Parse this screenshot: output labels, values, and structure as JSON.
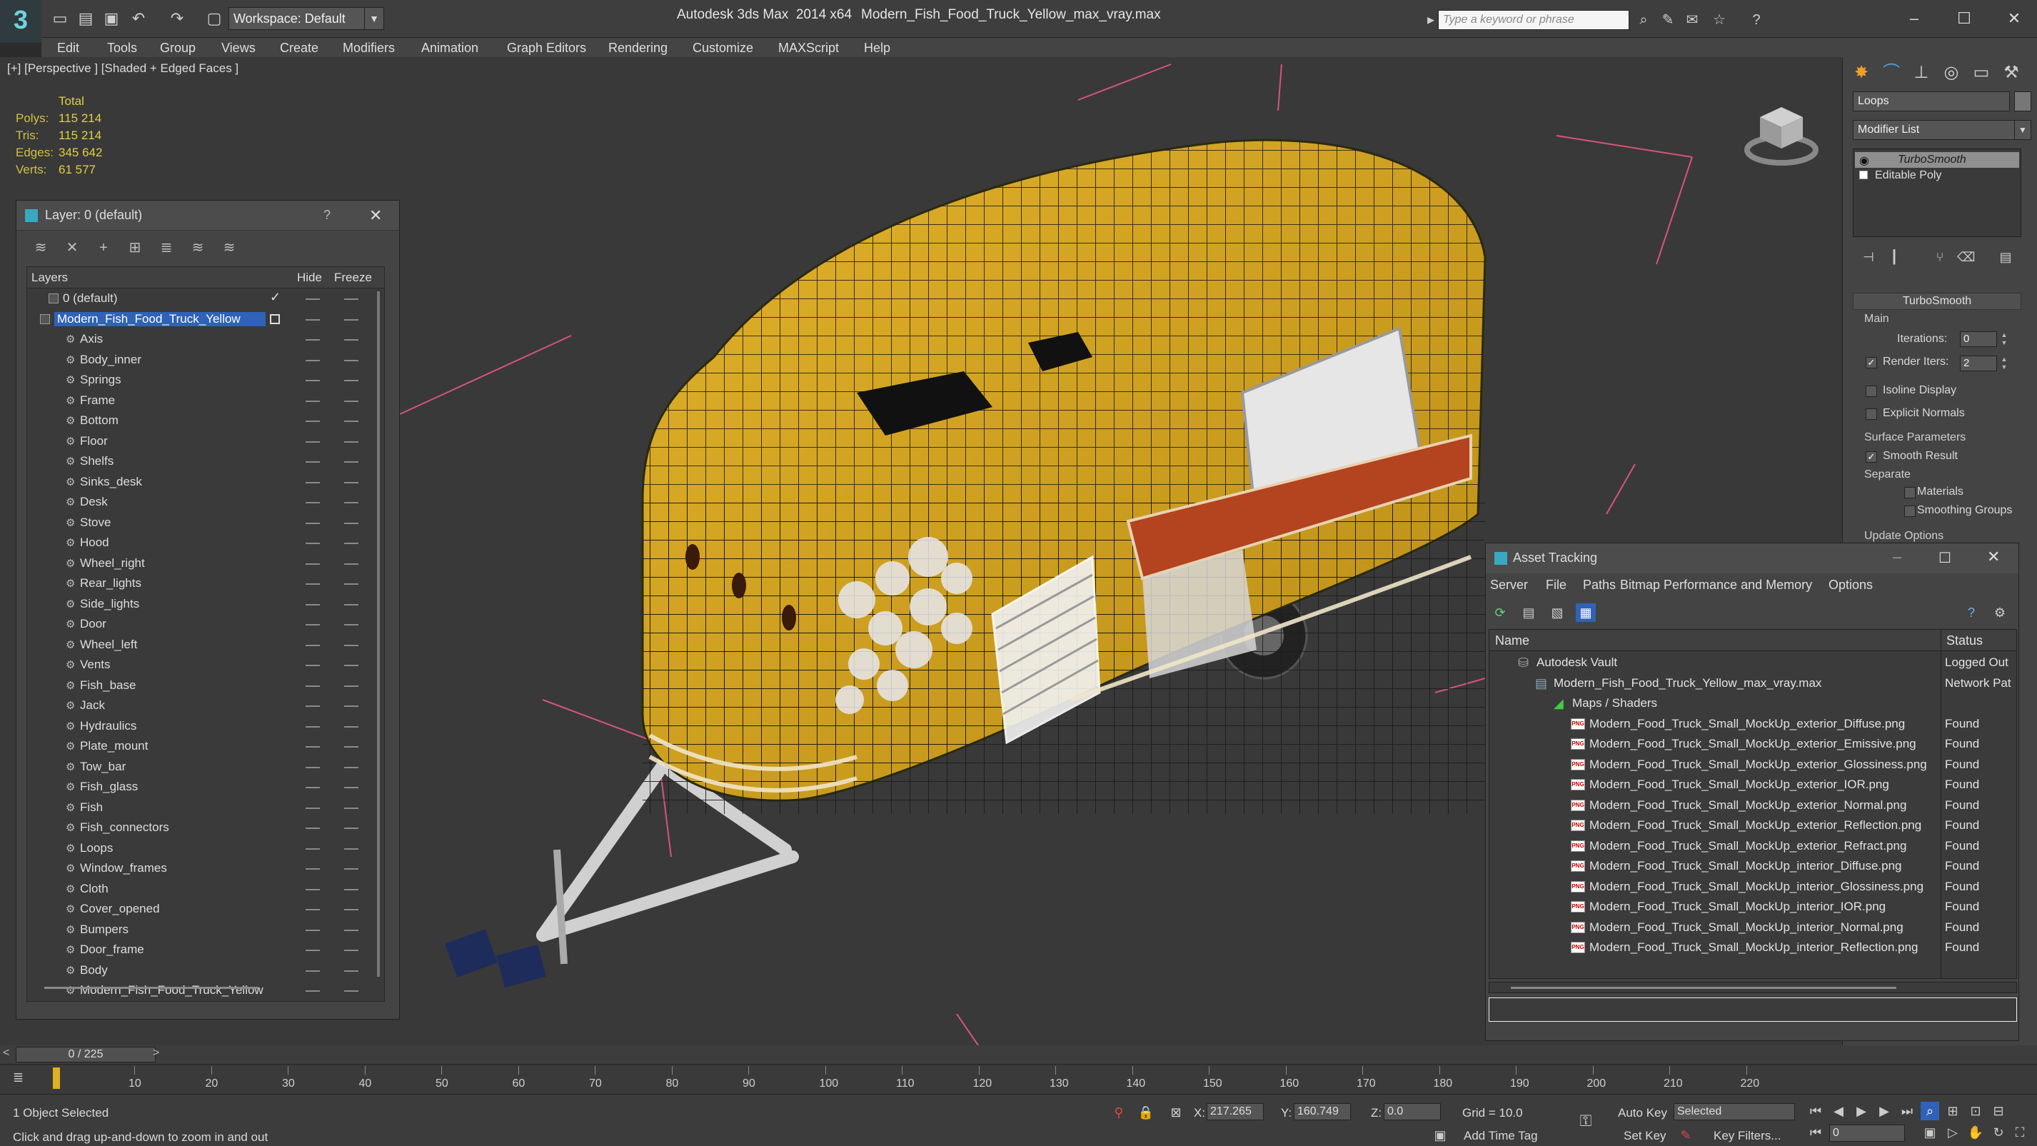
{
  "titlebar": {
    "workspace": "Workspace: Default",
    "app_title": "Autodesk 3ds Max  2014 x64",
    "file_title": "Modern_Fish_Food_Truck_Yellow_max_vray.max",
    "search_placeholder": "Type a keyword or phrase"
  },
  "menu": [
    "Edit",
    "Tools",
    "Group",
    "Views",
    "Create",
    "Modifiers",
    "Animation",
    "Graph Editors",
    "Rendering",
    "Customize",
    "MAXScript",
    "Help"
  ],
  "viewport": {
    "label": "[+] [Perspective ] [Shaded + Edged Faces ]",
    "stats": {
      "total_label": "Total",
      "rows": [
        {
          "label": "Polys:",
          "value": "115 214"
        },
        {
          "label": "Tris:",
          "value": "115 214"
        },
        {
          "label": "Edges:",
          "value": "345 642"
        },
        {
          "label": "Verts:",
          "value": "61 577"
        }
      ]
    }
  },
  "layer_dialog": {
    "title": "Layer: 0 (default)",
    "help": "?",
    "close": "✕",
    "columns": {
      "layers": "Layers",
      "hide": "Hide",
      "freeze": "Freeze"
    },
    "default_layer": "0 (default)",
    "selected_layer": "Modern_Fish_Food_Truck_Yellow",
    "objects": [
      "Axis",
      "Body_inner",
      "Springs",
      "Frame",
      "Bottom",
      "Floor",
      "Shelfs",
      "Sinks_desk",
      "Desk",
      "Stove",
      "Hood",
      "Wheel_right",
      "Rear_lights",
      "Side_lights",
      "Door",
      "Wheel_left",
      "Vents",
      "Fish_base",
      "Jack",
      "Hydraulics",
      "Plate_mount",
      "Tow_bar",
      "Fish_glass",
      "Fish",
      "Fish_connectors",
      "Loops",
      "Window_frames",
      "Cloth",
      "Cover_opened",
      "Bumpers",
      "Door_frame",
      "Body",
      "Modern_Fish_Food_Truck_Yellow"
    ]
  },
  "command_panel": {
    "object_name": "Loops",
    "modifier_list": "Modifier List",
    "stack": [
      "TurboSmooth",
      "Editable Poly"
    ],
    "rollout": "TurboSmooth",
    "main_group": "Main",
    "iterations_label": "Iterations:",
    "iterations_value": "0",
    "render_iters_label": "Render Iters:",
    "render_iters_value": "2",
    "render_iters_checked": true,
    "isoline_label": "Isoline Display",
    "isoline_checked": false,
    "explicit_label": "Explicit Normals",
    "explicit_checked": false,
    "surface_group": "Surface Parameters",
    "smooth_label": "Smooth Result",
    "smooth_checked": true,
    "separate_label": "Separate",
    "materials_label": "Materials",
    "smoothing_label": "Smoothing Groups",
    "update_group": "Update Options"
  },
  "asset_dialog": {
    "title": "Asset Tracking",
    "menu": [
      "Server",
      "File",
      "Paths",
      "Bitmap Performance and Memory",
      "Options"
    ],
    "col_name": "Name",
    "col_status": "Status",
    "rows": [
      {
        "name": "Autodesk Vault",
        "status": "Logged Out",
        "indent": 0,
        "icon": "vault"
      },
      {
        "name": "Modern_Fish_Food_Truck_Yellow_max_vray.max",
        "status": "Network Pat",
        "indent": 1,
        "icon": "max"
      },
      {
        "name": "Maps / Shaders",
        "status": "",
        "indent": 2,
        "icon": "maps"
      },
      {
        "name": "Modern_Food_Truck_Small_MockUp_exterior_Diffuse.png",
        "status": "Found",
        "indent": 3,
        "icon": "png"
      },
      {
        "name": "Modern_Food_Truck_Small_MockUp_exterior_Emissive.png",
        "status": "Found",
        "indent": 3,
        "icon": "png"
      },
      {
        "name": "Modern_Food_Truck_Small_MockUp_exterior_Glossiness.png",
        "status": "Found",
        "indent": 3,
        "icon": "png"
      },
      {
        "name": "Modern_Food_Truck_Small_MockUp_exterior_IOR.png",
        "status": "Found",
        "indent": 3,
        "icon": "png"
      },
      {
        "name": "Modern_Food_Truck_Small_MockUp_exterior_Normal.png",
        "status": "Found",
        "indent": 3,
        "icon": "png"
      },
      {
        "name": "Modern_Food_Truck_Small_MockUp_exterior_Reflection.png",
        "status": "Found",
        "indent": 3,
        "icon": "png"
      },
      {
        "name": "Modern_Food_Truck_Small_MockUp_exterior_Refract.png",
        "status": "Found",
        "indent": 3,
        "icon": "png"
      },
      {
        "name": "Modern_Food_Truck_Small_MockUp_interior_Diffuse.png",
        "status": "Found",
        "indent": 3,
        "icon": "png"
      },
      {
        "name": "Modern_Food_Truck_Small_MockUp_interior_Glossiness.png",
        "status": "Found",
        "indent": 3,
        "icon": "png"
      },
      {
        "name": "Modern_Food_Truck_Small_MockUp_interior_IOR.png",
        "status": "Found",
        "indent": 3,
        "icon": "png"
      },
      {
        "name": "Modern_Food_Truck_Small_MockUp_interior_Normal.png",
        "status": "Found",
        "indent": 3,
        "icon": "png"
      },
      {
        "name": "Modern_Food_Truck_Small_MockUp_interior_Reflection.png",
        "status": "Found",
        "indent": 3,
        "icon": "png"
      }
    ]
  },
  "timeline": {
    "frame_display": "0 / 225",
    "ticks": [
      "10",
      "20",
      "30",
      "40",
      "50",
      "60",
      "70",
      "80",
      "90",
      "100",
      "110",
      "120",
      "130",
      "140",
      "150",
      "160",
      "170",
      "180",
      "190",
      "200",
      "210",
      "220"
    ]
  },
  "statusbar": {
    "selection": "1 Object Selected",
    "prompt": "Click and drag up-and-down to zoom in and out",
    "x_label": "X:",
    "x_value": "217.265",
    "y_label": "Y:",
    "y_value": "160.749",
    "z_label": "Z:",
    "z_value": "0.0",
    "grid": "Grid = 10.0",
    "auto_key": "Auto Key",
    "set_key": "Set Key",
    "selected_dropdown": "Selected",
    "key_filters": "Key Filters...",
    "frame_field": "0",
    "add_time_tag": "Add Time Tag"
  },
  "colors": {
    "accent": "#2f62b8",
    "stats_text": "#e0d040",
    "truck_body": "#d8a521",
    "gizmo_lines": "#d8547a"
  }
}
